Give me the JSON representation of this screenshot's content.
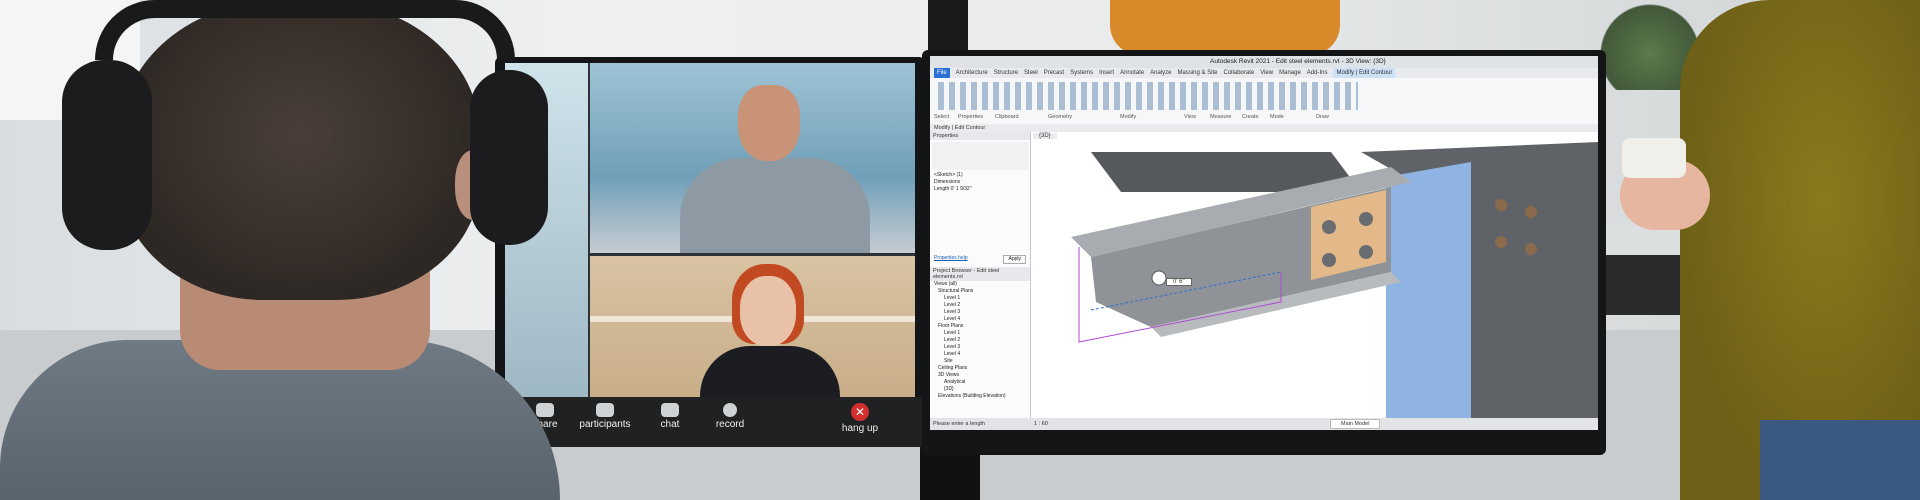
{
  "video_call": {
    "controls": [
      {
        "label": "share",
        "icon": "share-icon"
      },
      {
        "label": "participants",
        "icon": "participants-icon"
      },
      {
        "label": "chat",
        "icon": "chat-icon"
      },
      {
        "label": "record",
        "icon": "record-icon"
      },
      {
        "label": "hang up",
        "icon": "hang-up-icon"
      }
    ]
  },
  "cad_app": {
    "window_title": "Autodesk Revit 2021 - Edit steel elements.rvt - 3D View: {3D}",
    "ribbon_tabs": [
      "File",
      "Architecture",
      "Structure",
      "Steel",
      "Precast",
      "Systems",
      "Insert",
      "Annotate",
      "Analyze",
      "Massing & Site",
      "Collaborate",
      "View",
      "Manage",
      "Add-Ins",
      "Modify | Edit Contour"
    ],
    "active_tab": "File",
    "ribbon_groups": [
      "Select",
      "Properties",
      "Clipboard",
      "Geometry",
      "Modify",
      "View",
      "Measure",
      "Create",
      "Mode",
      "Draw"
    ],
    "mode_bar": "Modify | Edit Contour",
    "properties_header": "Properties",
    "properties_rows": [
      "<Sketch> (1)",
      "Dimensions",
      "Length      0' 1 9/32\""
    ],
    "properties_help": "Properties help",
    "apply_button": "Apply",
    "project_browser_header": "Project Browser - Edit steel elements.rvt",
    "project_tree": [
      "Views (all)",
      "Structural Plans",
      "Level 1",
      "Level 2",
      "Level 3",
      "Level 4",
      "Floor Plans",
      "Level 1",
      "Level 2",
      "Level 3",
      "Level 4",
      "Site",
      "Ceiling Plans",
      "3D Views",
      "Analytical",
      "{3D}",
      "Elevations (Building Elevation)"
    ],
    "view_tab": "{3D}",
    "dimension_label": "0' 6\"",
    "status_text": "Please enter a length",
    "scale": "1 : 60",
    "main_model": "Main Model"
  },
  "colors": {
    "ribbon_active": "#2a6fd1",
    "hang_up": "#d32f2f",
    "plate": "#e3b98a",
    "steel": "#9b9ea2",
    "column": "#8fb4e3"
  }
}
